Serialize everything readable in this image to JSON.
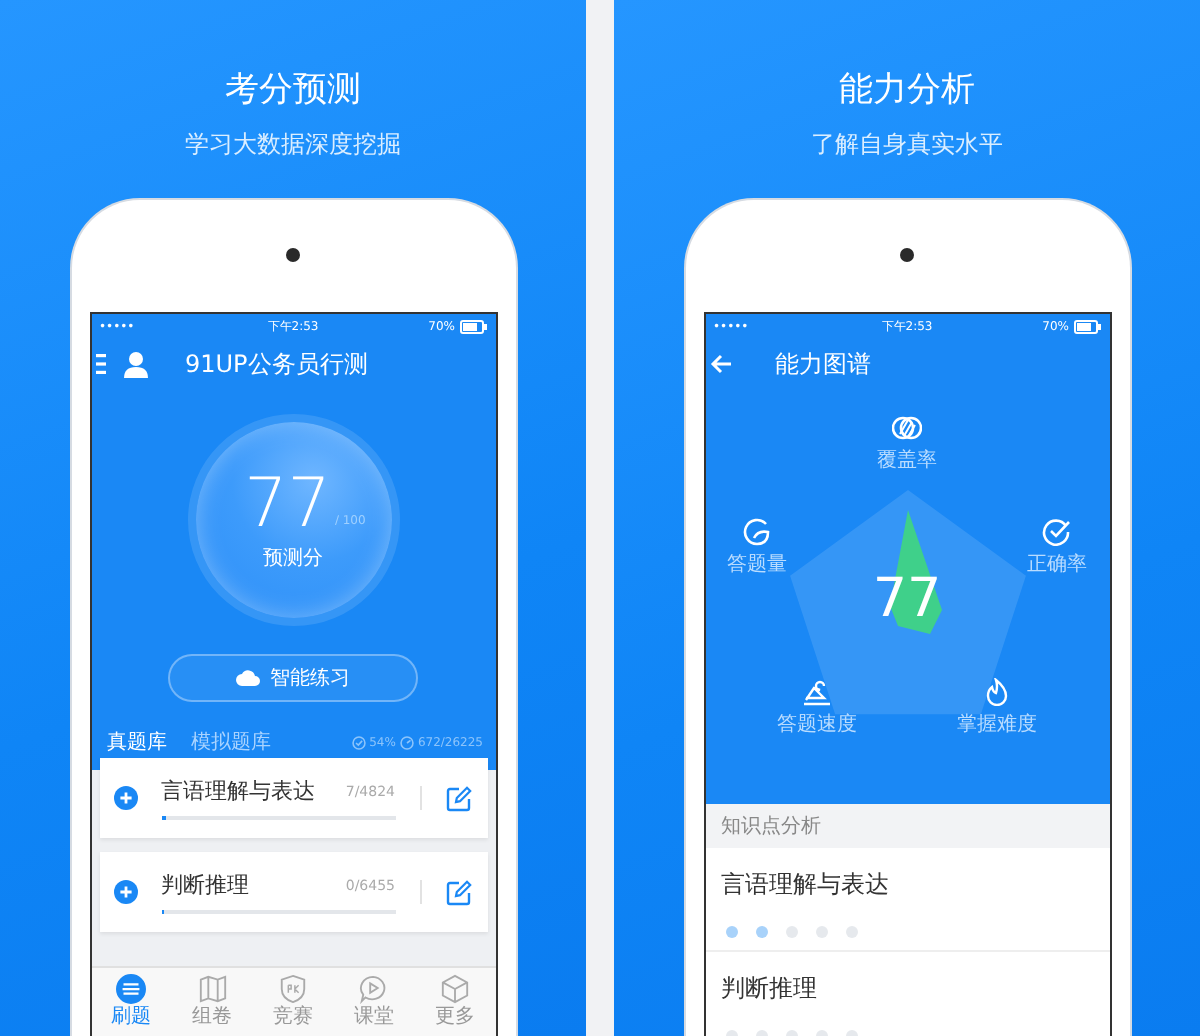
{
  "score_panel": {
    "title": "考分预测",
    "subtitle": "学习大数据深度挖掘",
    "status_bar": {
      "carrier": "•••••",
      "time": "下午2:53",
      "battery": "70%"
    },
    "app_title": "91UP公务员行测",
    "score": {
      "value": "77",
      "max": "/ 100",
      "label": "预测分"
    },
    "practice_button": "智能练习",
    "tabs": [
      {
        "label": "真题库",
        "selected": true
      },
      {
        "label": "模拟题库",
        "selected": false
      }
    ],
    "stats": {
      "accuracy": "54%",
      "progress": "672/26225"
    },
    "subjects": [
      {
        "name": "言语理解与表达",
        "count": "7/4824",
        "level": 0.02
      },
      {
        "name": "判断推理",
        "count": "0/6455",
        "level": 0
      }
    ],
    "nav": [
      {
        "label": "刷题",
        "selected": true
      },
      {
        "label": "组卷",
        "selected": false
      },
      {
        "label": "竞赛",
        "selected": false
      },
      {
        "label": "课堂",
        "selected": false
      },
      {
        "label": "更多",
        "selected": false
      }
    ]
  },
  "ability_panel": {
    "title": "能力分析",
    "subtitle": "了解自身真实水平",
    "status_bar": {
      "carrier": "•••••",
      "time": "下午2:53",
      "battery": "70%"
    },
    "screen_title": "能力图谱",
    "radar": {
      "score": "77",
      "axes": [
        {
          "label": "覆盖率"
        },
        {
          "label": "正确率"
        },
        {
          "label": "掌握难度"
        },
        {
          "label": "答题速度"
        },
        {
          "label": "答题量"
        }
      ]
    },
    "section_header": "知识点分析",
    "topics": [
      {
        "name": "言语理解与表达",
        "stars": 2
      },
      {
        "name": "判断推理",
        "stars": 0
      }
    ]
  }
}
